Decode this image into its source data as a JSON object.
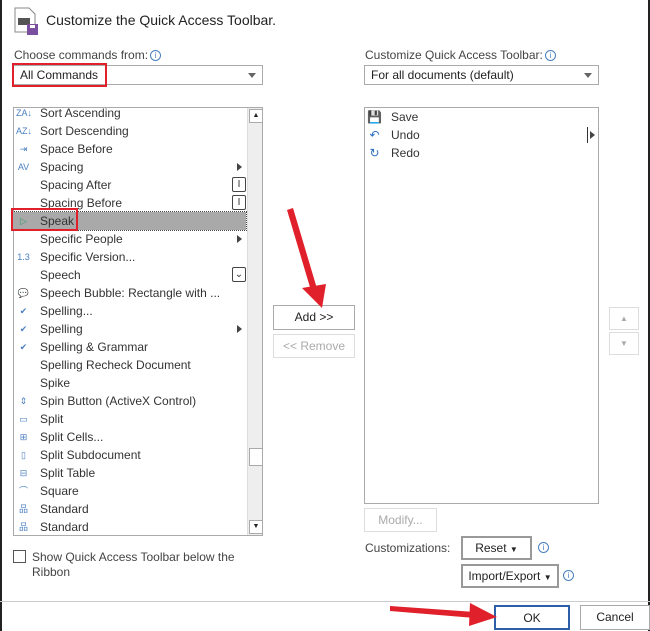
{
  "dialog": {
    "title": "Customize the Quick Access Toolbar."
  },
  "left": {
    "label": "Choose commands from:",
    "selected": "All Commands",
    "items": [
      {
        "label": "Sort Ascending",
        "icon": "sort-ascending-icon",
        "glyph": "ZA↓"
      },
      {
        "label": "Sort Descending",
        "icon": "sort-descending-icon",
        "glyph": "AZ↓"
      },
      {
        "label": "Space Before",
        "icon": "space-before-icon",
        "glyph": "⇥"
      },
      {
        "label": "Spacing",
        "icon": "spacing-icon",
        "glyph": "AV",
        "submenu": true
      },
      {
        "label": "Spacing After",
        "icon": "",
        "glyph": "",
        "box": "I"
      },
      {
        "label": "Spacing Before",
        "icon": "",
        "glyph": "",
        "box": "I"
      },
      {
        "label": "Speak",
        "icon": "speak-icon",
        "glyph": "▷",
        "selected": true
      },
      {
        "label": "Specific People",
        "icon": "",
        "glyph": "",
        "submenu": true
      },
      {
        "label": "Specific Version...",
        "icon": "specific-version-icon",
        "glyph": "1.3"
      },
      {
        "label": "Speech",
        "icon": "",
        "glyph": "",
        "box": "⌄"
      },
      {
        "label": "Speech Bubble: Rectangle with ...",
        "icon": "speech-bubble-icon",
        "glyph": "💬"
      },
      {
        "label": "Spelling...",
        "icon": "spelling-check-icon",
        "glyph": "✔"
      },
      {
        "label": "Spelling",
        "icon": "spelling-check-icon",
        "glyph": "✔",
        "submenu": true
      },
      {
        "label": "Spelling & Grammar",
        "icon": "spelling-check-icon",
        "glyph": "✔"
      },
      {
        "label": "Spelling Recheck Document",
        "icon": "",
        "glyph": ""
      },
      {
        "label": "Spike",
        "icon": "",
        "glyph": ""
      },
      {
        "label": "Spin Button (ActiveX Control)",
        "icon": "spin-button-icon",
        "glyph": "⇕"
      },
      {
        "label": "Split",
        "icon": "split-icon",
        "glyph": "▭"
      },
      {
        "label": "Split Cells...",
        "icon": "split-cells-icon",
        "glyph": "⊞"
      },
      {
        "label": "Split Subdocument",
        "icon": "split-subdocument-icon",
        "glyph": "▯"
      },
      {
        "label": "Split Table",
        "icon": "split-table-icon",
        "glyph": "⊟"
      },
      {
        "label": "Square",
        "icon": "square-wrap-icon",
        "glyph": "⌒"
      },
      {
        "label": "Standard",
        "icon": "org-chart-icon",
        "glyph": "品"
      },
      {
        "label": "Standard",
        "icon": "org-chart-icon",
        "glyph": "品"
      }
    ],
    "show_below": "Show Quick Access Toolbar below the Ribbon"
  },
  "middle": {
    "add": "Add >>",
    "remove": "<< Remove"
  },
  "right": {
    "label": "Customize Quick Access Toolbar:",
    "selected": "For all documents (default)",
    "items": [
      {
        "label": "Save",
        "icon": "save-icon",
        "glyph": "💾",
        "color": "#7b4fa0"
      },
      {
        "label": "Undo",
        "icon": "undo-icon",
        "glyph": "↶",
        "color": "#2e6fc0"
      },
      {
        "label": "Redo",
        "icon": "redo-icon",
        "glyph": "↻",
        "color": "#2e6fc0"
      }
    ],
    "modify": "Modify...",
    "customizations_label": "Customizations:",
    "reset": "Reset",
    "import_export": "Import/Export"
  },
  "footer": {
    "ok": "OK",
    "cancel": "Cancel"
  },
  "colors": {
    "highlight": "#e0202a",
    "selection": "#a9a9a9",
    "ok_border": "#2d5fa8"
  }
}
